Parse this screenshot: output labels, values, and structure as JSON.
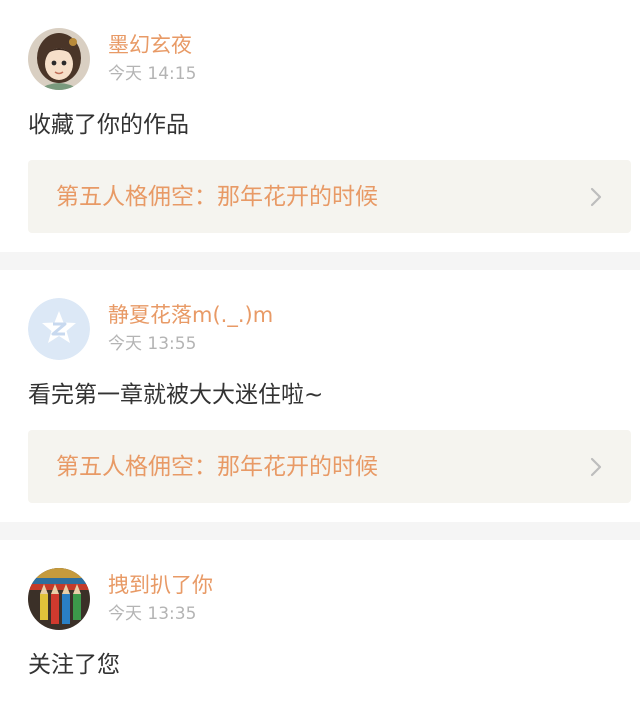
{
  "notifications": [
    {
      "username": "墨幻玄夜",
      "time": "今天 14:15",
      "message": "收藏了你的作品",
      "work_title": "第五人格佣空：那年花开的时候",
      "avatar": "anime-character-avatar"
    },
    {
      "username": "静夏花落m(._.)m",
      "time": "今天 13:55",
      "message": "看完第一章就被大大迷住啦~",
      "work_title": "第五人格佣空：那年花开的时候",
      "avatar": "default-z-avatar"
    },
    {
      "username": "拽到扒了你",
      "time": "今天 13:35",
      "message": "关注了您",
      "avatar": "colored-pencils-avatar"
    }
  ],
  "colors": {
    "accent": "#e89a66",
    "timestamp": "#b4b4b4",
    "message": "#333333",
    "link_background": "#f5f4ef",
    "page_background": "#f5f5f5",
    "default_avatar": "#dce8f6"
  }
}
